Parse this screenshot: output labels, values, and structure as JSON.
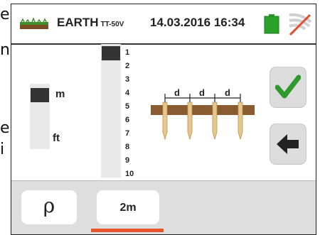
{
  "page_edge": {
    "letter_1": "e",
    "letter_2": "n",
    "letter_3": "e",
    "letter_4": "i"
  },
  "status_bar": {
    "mode_title": "EARTH",
    "mode_subtitle": "TT-50V",
    "date": "14.03.2016",
    "time": "16:34",
    "battery_color": "#2aa22a",
    "wifi_state": "disabled"
  },
  "unit_selector": {
    "options": [
      "m",
      "ft"
    ],
    "selected": "m"
  },
  "distance_selector": {
    "values": [
      "1",
      "2",
      "3",
      "4",
      "5",
      "6",
      "7",
      "8",
      "9",
      "10"
    ],
    "selected": "1"
  },
  "diagram": {
    "spacing_labels": [
      "d",
      "d",
      "d"
    ]
  },
  "actions": {
    "confirm_icon": "checkmark-icon",
    "back_icon": "back-arrow-icon",
    "confirm_color": "#2e9a2e"
  },
  "bottom_tabs": {
    "rho_label": "ρ",
    "distance_label": "2m",
    "active_indicator_color": "#e8542b"
  }
}
